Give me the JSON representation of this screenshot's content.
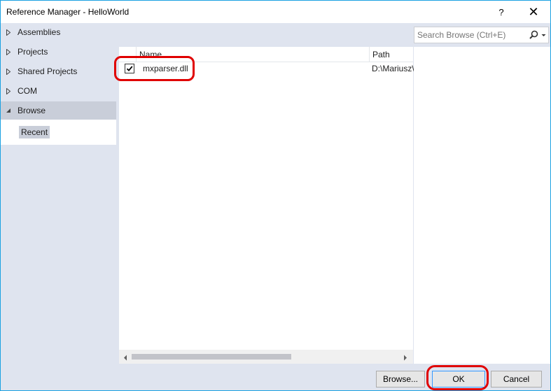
{
  "window": {
    "title": "Reference Manager - HelloWorld",
    "help_label": "?",
    "close_label": "✕"
  },
  "nav": {
    "items": [
      {
        "label": "Assemblies",
        "expanded": false
      },
      {
        "label": "Projects",
        "expanded": false
      },
      {
        "label": "Shared Projects",
        "expanded": false
      },
      {
        "label": "COM",
        "expanded": false
      },
      {
        "label": "Browse",
        "expanded": true,
        "selected": true
      }
    ],
    "sub_item": "Recent"
  },
  "search": {
    "placeholder": "Search Browse (Ctrl+E)"
  },
  "list": {
    "columns": [
      "Name",
      "Path"
    ],
    "rows": [
      {
        "checked": true,
        "name": "mxparser.dll",
        "path": "D:\\Mariusz\\"
      }
    ]
  },
  "buttons": {
    "browse": "Browse...",
    "ok": "OK",
    "cancel": "Cancel"
  },
  "colors": {
    "window_border": "#1ba1e2",
    "annotation": "#e00000",
    "selection": "#c9ced9"
  }
}
